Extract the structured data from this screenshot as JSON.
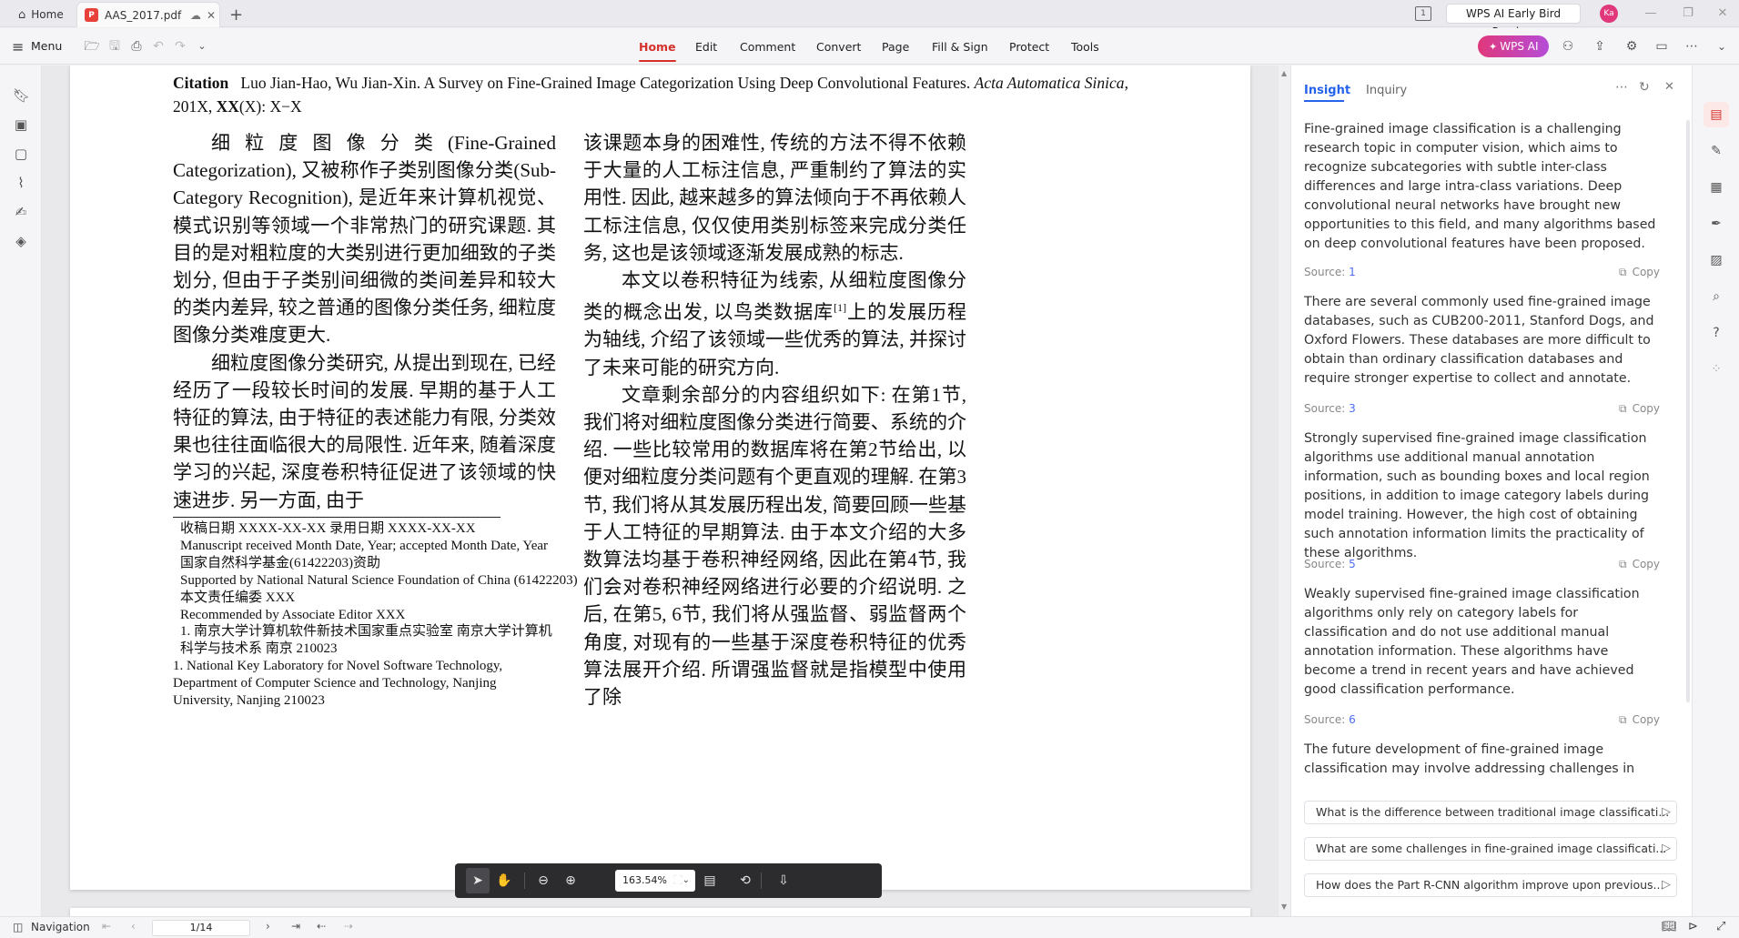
{
  "titlebar": {
    "home_label": "Home",
    "file_tab": "AAS_2017.pdf",
    "wps_ai_preview": "WPS AI Early Bird Preview",
    "avatar_initials": "Ka"
  },
  "menubar": {
    "menu_label": "Menu",
    "tabs": [
      "Home",
      "Edit",
      "Comment",
      "Convert",
      "Page",
      "Fill & Sign",
      "Protect",
      "Tools"
    ],
    "active_tab": "Home",
    "wps_ai_button": "WPS AI"
  },
  "document": {
    "citation_label": "Citation",
    "citation_text": "Luo Jian-Hao, Wu Jian-Xin.  A Survey on Fine-Grained Image Categorization Using Deep Convolutional Features.",
    "citation_journal": "Acta Automatica Sinica",
    "citation_tail": ", 201X, ",
    "citation_vol": "XX",
    "citation_end": "(X): X−X",
    "left_column": [
      "细粒度图像分类(Fine-Grained Categorization), 又被称作子类别图像分类(Sub-Category Recognition), 是近年来计算机视觉、模式识别等领域一个非常热门的研究课题. 其目的是对粗粒度的大类别进行更加细致的子类划分, 但由于子类别间细微的类间差异和较大的类内差异, 较之普通的图像分类任务, 细粒度图像分类难度更大.",
      "细粒度图像分类研究, 从提出到现在, 已经经历了一段较长时间的发展. 早期的基于人工特征的算法, 由于特征的表述能力有限, 分类效果也往往面临很大的局限性. 近年来, 随着深度学习的兴起, 深度卷积特征促进了该领域的快速进步. 另一方面, 由于"
    ],
    "right_column_cont": "该课题本身的困难性, 传统的方法不得不依赖于大量的人工标注信息, 严重制约了算法的实用性. 因此, 越来越多的算法倾向于不再依赖人工标注信息, 仅仅使用类别标签来完成分类任务, 这也是该领域逐渐发展成熟的标志.",
    "right_column_p2a": "本文以卷积特征为线索, 从细粒度图像分类的概念出发, 以鸟类数据库",
    "right_column_ref": "[1]",
    "right_column_p2b": "上的发展历程为轴线, 介绍了该领域一些优秀的算法, 并探讨了未来可能的研究方向.",
    "right_column_p3": "文章剩余部分的内容组织如下: 在第1节, 我们将对细粒度图像分类进行简要、系统的介绍. 一些比较常用的数据库将在第2节给出, 以便对细粒度分类问题有个更直观的理解. 在第3节, 我们将从其发展历程出发, 简要回顾一些基于人工特征的早期算法. 由于本文介绍的大多数算法均基于卷积神经网络, 因此在第4节, 我们会对卷积神经网络进行必要的介绍说明. 之后, 在第5, 6节, 我们将从强监督、弱监督两个角度, 对现有的一些基于深度卷积特征的优秀算法展开介绍. 所谓强监督就是指模型中使用了除",
    "footnotes": [
      "收稿日期 XXXX-XX-XX     录用日期 XXXX-XX-XX",
      "Manuscript received Month Date, Year; accepted Month Date, Year",
      "国家自然科学基金(61422203)资助",
      "Supported by National Natural Science Foundation of China (61422203)",
      "本文责任编委 XXX",
      "Recommended by Associate Editor XXX",
      "1. 南京大学计算机软件新技术国家重点实验室 南京大学计算机科学与技术系 南京 210023",
      "1. National Key Laboratory for Novel Software Technology, Department of Computer Science and Technology, Nanjing University, Nanjing 210023"
    ]
  },
  "floatbar": {
    "zoom": "163.54%"
  },
  "insight": {
    "tabs": [
      "Insight",
      "Inquiry"
    ],
    "active_tab": "Insight",
    "source_label": "Source:",
    "copy_label": "Copy",
    "items": [
      {
        "text": "Fine-grained image classification is a challenging research topic in computer vision, which aims to recognize subcategories with subtle inter-class differences and large intra-class variations. Deep convolutional neural networks have brought new opportunities to this field, and many algorithms based on deep convolutional features have been proposed.",
        "source": "1"
      },
      {
        "text": "There are several commonly used fine-grained image databases, such as CUB200-2011, Stanford Dogs, and Oxford Flowers. These databases are more difficult to obtain than ordinary classification databases and require stronger expertise to collect and annotate.",
        "source": "3"
      },
      {
        "text": "Strongly supervised fine-grained image classification algorithms use additional manual annotation information, such as bounding boxes and local region positions, in addition to image category labels during model training. However, the high cost of obtaining such annotation information limits the practicality of these algorithms.",
        "source": "5"
      },
      {
        "text": "Weakly supervised fine-grained image classification algorithms only rely on category labels for classification and do not use additional manual annotation information. These algorithms have become a trend in recent years and have achieved good classification performance.",
        "source": "6"
      }
    ],
    "partial_text": "The future development of fine-grained image classification may involve addressing challenges in",
    "suggestions": [
      "What is the difference between traditional image classificati...",
      "What are some challenges in fine-grained image classificati...",
      "How does the Part R-CNN algorithm improve upon previous..."
    ]
  },
  "statusbar": {
    "navigation_label": "Navigation",
    "page_indicator": "1/14"
  },
  "colors": {
    "accent_red": "#d6302a",
    "wps_ai": "#e0387b",
    "source_link": "#4a6cf7"
  }
}
